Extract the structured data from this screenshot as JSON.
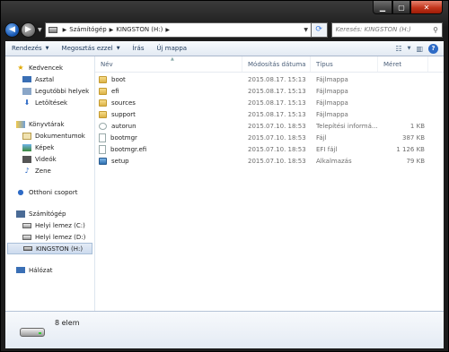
{
  "window": {
    "caption": {
      "minimize": "▁",
      "maximize": "▢",
      "close": "✕"
    }
  },
  "address": {
    "crumbs": [
      "Számítógép",
      "KINGSTON (H:)"
    ],
    "separator": "▶",
    "dropdown": "▼"
  },
  "search": {
    "placeholder": "Keresés: KINGSTON (H:)"
  },
  "toolbar": {
    "organize": "Rendezés",
    "share": "Megosztás ezzel",
    "burn": "Írás",
    "new_folder": "Új mappa",
    "dropdown_arrow": "▼"
  },
  "sidebar": {
    "favorites": {
      "label": "Kedvencek",
      "icon": "star-icon"
    },
    "favorites_items": [
      {
        "label": "Asztal",
        "icon": "desktop-icon"
      },
      {
        "label": "Legutóbbi helyek",
        "icon": "recent-places-icon"
      },
      {
        "label": "Letöltések",
        "icon": "downloads-icon"
      }
    ],
    "libraries": {
      "label": "Könyvtárak",
      "icon": "libraries-icon"
    },
    "libraries_items": [
      {
        "label": "Dokumentumok",
        "icon": "documents-icon"
      },
      {
        "label": "Képek",
        "icon": "pictures-icon"
      },
      {
        "label": "Videók",
        "icon": "videos-icon"
      },
      {
        "label": "Zene",
        "icon": "music-icon"
      }
    ],
    "homegroup": {
      "label": "Otthoni csoport",
      "icon": "homegroup-icon"
    },
    "computer": {
      "label": "Számítógép",
      "icon": "computer-icon"
    },
    "computer_items": [
      {
        "label": "Helyi lemez (C:)",
        "icon": "drive-icon"
      },
      {
        "label": "Helyi lemez (D:)",
        "icon": "drive-icon"
      },
      {
        "label": "KINGSTON (H:)",
        "icon": "usb-drive-icon",
        "selected": true
      }
    ],
    "network": {
      "label": "Hálózat",
      "icon": "network-icon"
    }
  },
  "columns": {
    "name": "Név",
    "date": "Módosítás dátuma",
    "type": "Típus",
    "size": "Méret"
  },
  "files": [
    {
      "name": "boot",
      "date": "2015.08.17. 15:13",
      "type": "Fájlmappa",
      "size": "",
      "icon": "folder"
    },
    {
      "name": "efi",
      "date": "2015.08.17. 15:13",
      "type": "Fájlmappa",
      "size": "",
      "icon": "folder"
    },
    {
      "name": "sources",
      "date": "2015.08.17. 15:13",
      "type": "Fájlmappa",
      "size": "",
      "icon": "folder"
    },
    {
      "name": "support",
      "date": "2015.08.17. 15:13",
      "type": "Fájlmappa",
      "size": "",
      "icon": "folder"
    },
    {
      "name": "autorun",
      "date": "2015.07.10. 18:53",
      "type": "Telepítési informá...",
      "size": "1 KB",
      "icon": "autorun"
    },
    {
      "name": "bootmgr",
      "date": "2015.07.10. 18:53",
      "type": "Fájl",
      "size": "387 KB",
      "icon": "doc"
    },
    {
      "name": "bootmgr.efi",
      "date": "2015.07.10. 18:53",
      "type": "EFI fájl",
      "size": "1 126 KB",
      "icon": "doc"
    },
    {
      "name": "setup",
      "date": "2015.07.10. 18:53",
      "type": "Alkalmazás",
      "size": "79 KB",
      "icon": "setup"
    }
  ],
  "status": {
    "item_count": "8 elem"
  }
}
